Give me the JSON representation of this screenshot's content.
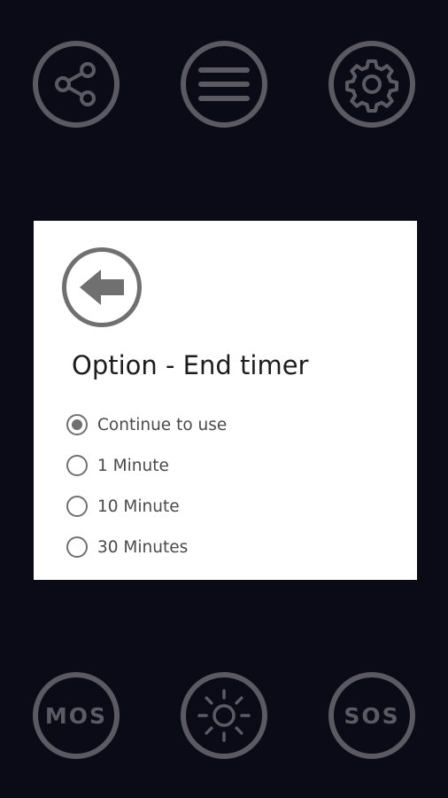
{
  "top_bar": {
    "share": {
      "icon": "share-icon"
    },
    "menu": {
      "icon": "hamburger-menu-icon"
    },
    "settings": {
      "icon": "gear-icon"
    }
  },
  "dialog": {
    "back_icon": "back-arrow-icon",
    "title": "Option - End timer",
    "options": [
      {
        "label": "Continue to use",
        "selected": true
      },
      {
        "label": "1 Minute",
        "selected": false
      },
      {
        "label": "10 Minute",
        "selected": false
      },
      {
        "label": "30 Minutes",
        "selected": false
      }
    ]
  },
  "bottom_bar": {
    "mos_label": "MOS",
    "light": {
      "icon": "sun-icon"
    },
    "sos_label": "SOS"
  },
  "colors": {
    "background": "#0b0a17",
    "button_outline": "#5b5a63",
    "dialog_bg": "#ffffff",
    "radio": "#707070"
  }
}
